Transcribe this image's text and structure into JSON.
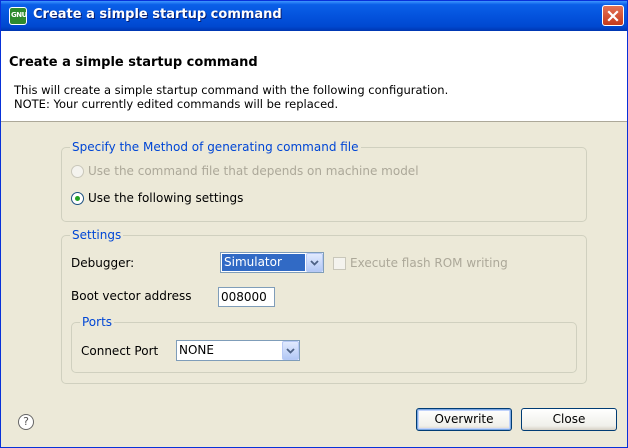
{
  "window": {
    "title": "Create a simple startup command",
    "icon_text": "GNU"
  },
  "header": {
    "title": "Create a simple startup command",
    "line1": "This will create a simple startup command with the following configuration.",
    "line2": "NOTE: Your currently edited commands will be replaced."
  },
  "method_group": {
    "legend": "Specify the Method of generating command file",
    "option1": "Use the command file that depends on machine model",
    "option2": "Use the following settings",
    "selected_option": 2
  },
  "settings_group": {
    "legend": "Settings",
    "debugger_label": "Debugger:",
    "debugger_value": "Simulator",
    "execute_flash_label": "Execute flash ROM writing",
    "execute_flash_checked": false,
    "boot_vector_label": "Boot vector address",
    "boot_vector_value": "008000"
  },
  "ports_group": {
    "legend": "Ports",
    "connect_port_label": "Connect Port",
    "connect_port_value": "NONE"
  },
  "buttons": {
    "overwrite": "Overwrite",
    "close": "Close"
  },
  "icons": {
    "help": "help-icon",
    "close": "close-icon",
    "dropdown": "chevron-down-icon"
  },
  "colors": {
    "titlebar": "#0453dd",
    "legend_text": "#0046d5",
    "selection": "#316ac5",
    "radio_dot": "#21a121"
  }
}
